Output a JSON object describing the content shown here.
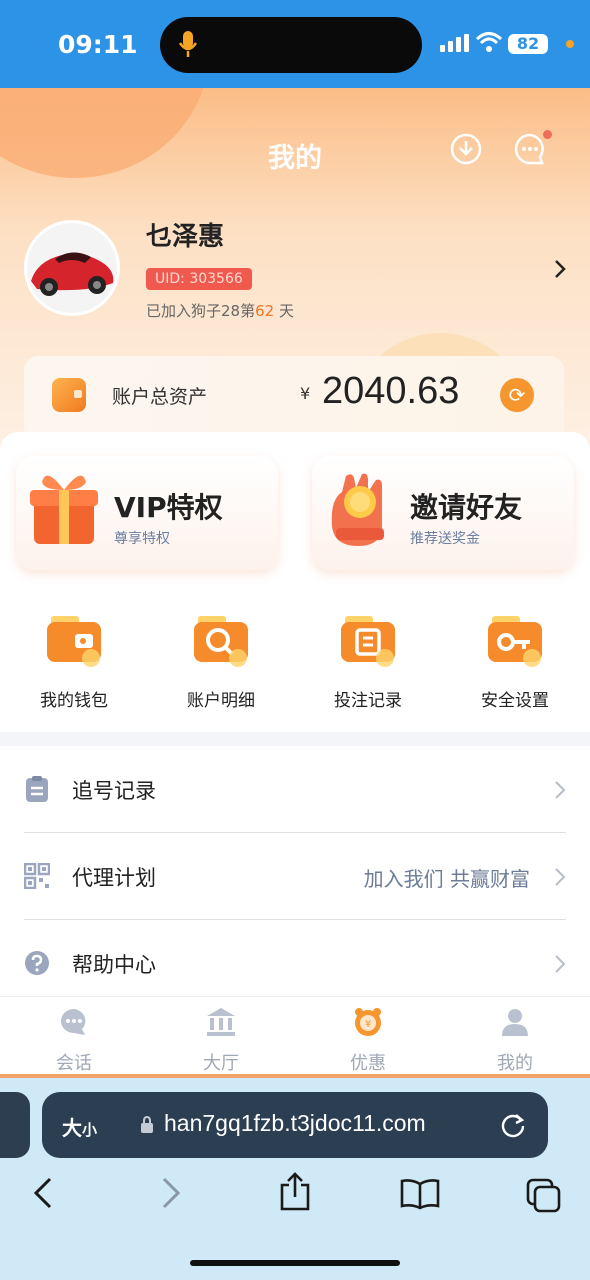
{
  "status_bar": {
    "time": "09:11",
    "battery": "82"
  },
  "header": {
    "title": "我的"
  },
  "profile": {
    "name": "乜泽惠",
    "uid": "UID: 303566",
    "joined_prefix": "已加入狗子28第",
    "joined_days": "62",
    "joined_suffix": "天"
  },
  "assets": {
    "label": "账户总资产",
    "currency": "¥",
    "value": "2040.63"
  },
  "promos": [
    {
      "title": "VIP特权",
      "subtitle": "尊享特权"
    },
    {
      "title": "邀请好友",
      "subtitle": "推荐送奖金"
    }
  ],
  "shortcuts": [
    {
      "label": "我的钱包",
      "icon": "wallet-icon"
    },
    {
      "label": "账户明细",
      "icon": "search-icon"
    },
    {
      "label": "投注记录",
      "icon": "record-icon"
    },
    {
      "label": "安全设置",
      "icon": "key-icon"
    }
  ],
  "menu": [
    {
      "label": "追号记录",
      "extra": "",
      "icon": "clipboard-icon"
    },
    {
      "label": "代理计划",
      "extra": "加入我们 共赢财富",
      "icon": "qr-icon"
    },
    {
      "label": "帮助中心",
      "extra": "",
      "icon": "help-icon"
    }
  ],
  "tabs": [
    {
      "label": "会话",
      "icon": "chat-icon"
    },
    {
      "label": "大厅",
      "icon": "bank-icon"
    },
    {
      "label": "优惠",
      "icon": "gift-icon"
    },
    {
      "label": "我的",
      "icon": "user-icon"
    }
  ],
  "browser": {
    "text_size": "大",
    "text_size_small": "小",
    "url": "han7gq1fzb.t3jdoc11.com"
  },
  "colors": {
    "status_bar": "#2d93e6",
    "accent": "#f5962f",
    "uid_badge": "#f05a4e"
  }
}
